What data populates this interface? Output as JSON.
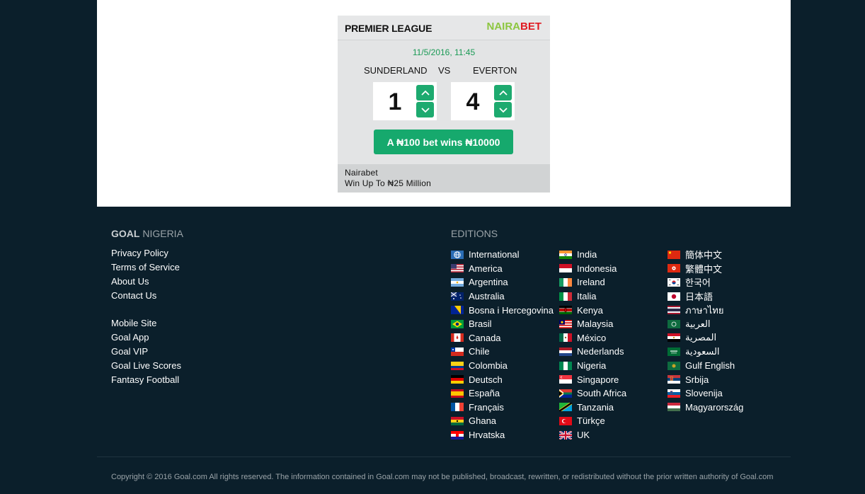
{
  "widget": {
    "league": "PREMIER LEAGUE",
    "brand_part1": "NAIRA",
    "brand_part2": "BET",
    "datetime": "11/5/2016, 11:45",
    "home_team": "SUNDERLAND",
    "vs": "VS",
    "away_team": "EVERTON",
    "home_score": "1",
    "away_score": "4",
    "bet_label": "A ₦100 bet wins ₦10000",
    "footer_line1": "Nairabet",
    "footer_line2": "Win Up To ₦25 Million"
  },
  "footer": {
    "brand_bold": "GOAL",
    "brand_rest": " NIGERIA",
    "links_group1": [
      "Privacy Policy",
      "Terms of Service",
      "About Us",
      "Contact Us"
    ],
    "links_group2": [
      "Mobile Site",
      "Goal App",
      "Goal VIP",
      "Goal Live Scores",
      "Fantasy Football"
    ],
    "editions_title": "EDITIONS",
    "editions_col1": [
      "International",
      "America",
      "Argentina",
      "Australia",
      "Bosna i Hercegovina",
      "Brasil",
      "Canada",
      "Chile",
      "Colombia",
      "Deutsch",
      "España",
      "Français",
      "Ghana",
      "Hrvatska"
    ],
    "editions_col2": [
      "India",
      "Indonesia",
      "Ireland",
      "Italia",
      "Kenya",
      "Malaysia",
      "México",
      "Nederlands",
      "Nigeria",
      "Singapore",
      "South Africa",
      "Tanzania",
      "Türkçe",
      "UK"
    ],
    "editions_col3": [
      "簡体中文",
      "繁體中文",
      "한국어",
      "日本語",
      "ภาษาไทย",
      "العربية",
      "المصرية",
      "السعودية",
      "Gulf English",
      "Srbija",
      "Slovenija",
      "Magyarország"
    ],
    "copyright": "Copyright © 2016 Goal.com All rights reserved. The information contained in Goal.com may not be published, broadcast, rewritten, or redistributed without the prior written authority of Goal.com"
  },
  "colors": {
    "page_bg": "#0b1f2b",
    "accent_green": "#16a96d",
    "brand_green": "#8cc63f",
    "brand_red": "#e01b22"
  }
}
